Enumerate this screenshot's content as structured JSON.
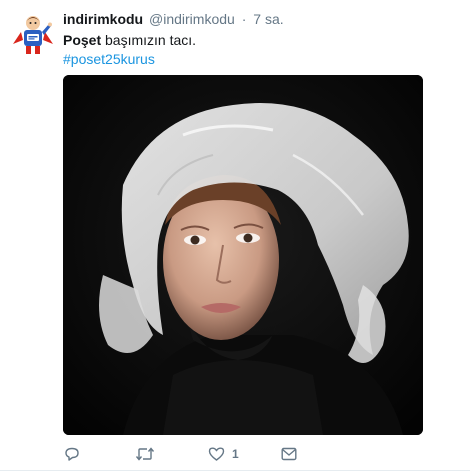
{
  "tweet": {
    "fullname": "indirimkodu",
    "username": "@indirimkodu",
    "separator": "·",
    "time": "7 sa.",
    "text_bold": "Poşet",
    "text_rest": " başımızın tacı.",
    "hashtag": "#poset25kurus"
  },
  "actions": {
    "reply_count": "",
    "retweet_count": "",
    "like_count": "1",
    "message_count": ""
  },
  "colors": {
    "link": "#1b95e0",
    "secondary_text": "#657786",
    "primary_text": "#14171a"
  },
  "icons": [
    "avatar-superhero-icon",
    "reply-icon",
    "retweet-icon",
    "heart-icon",
    "envelope-icon"
  ]
}
